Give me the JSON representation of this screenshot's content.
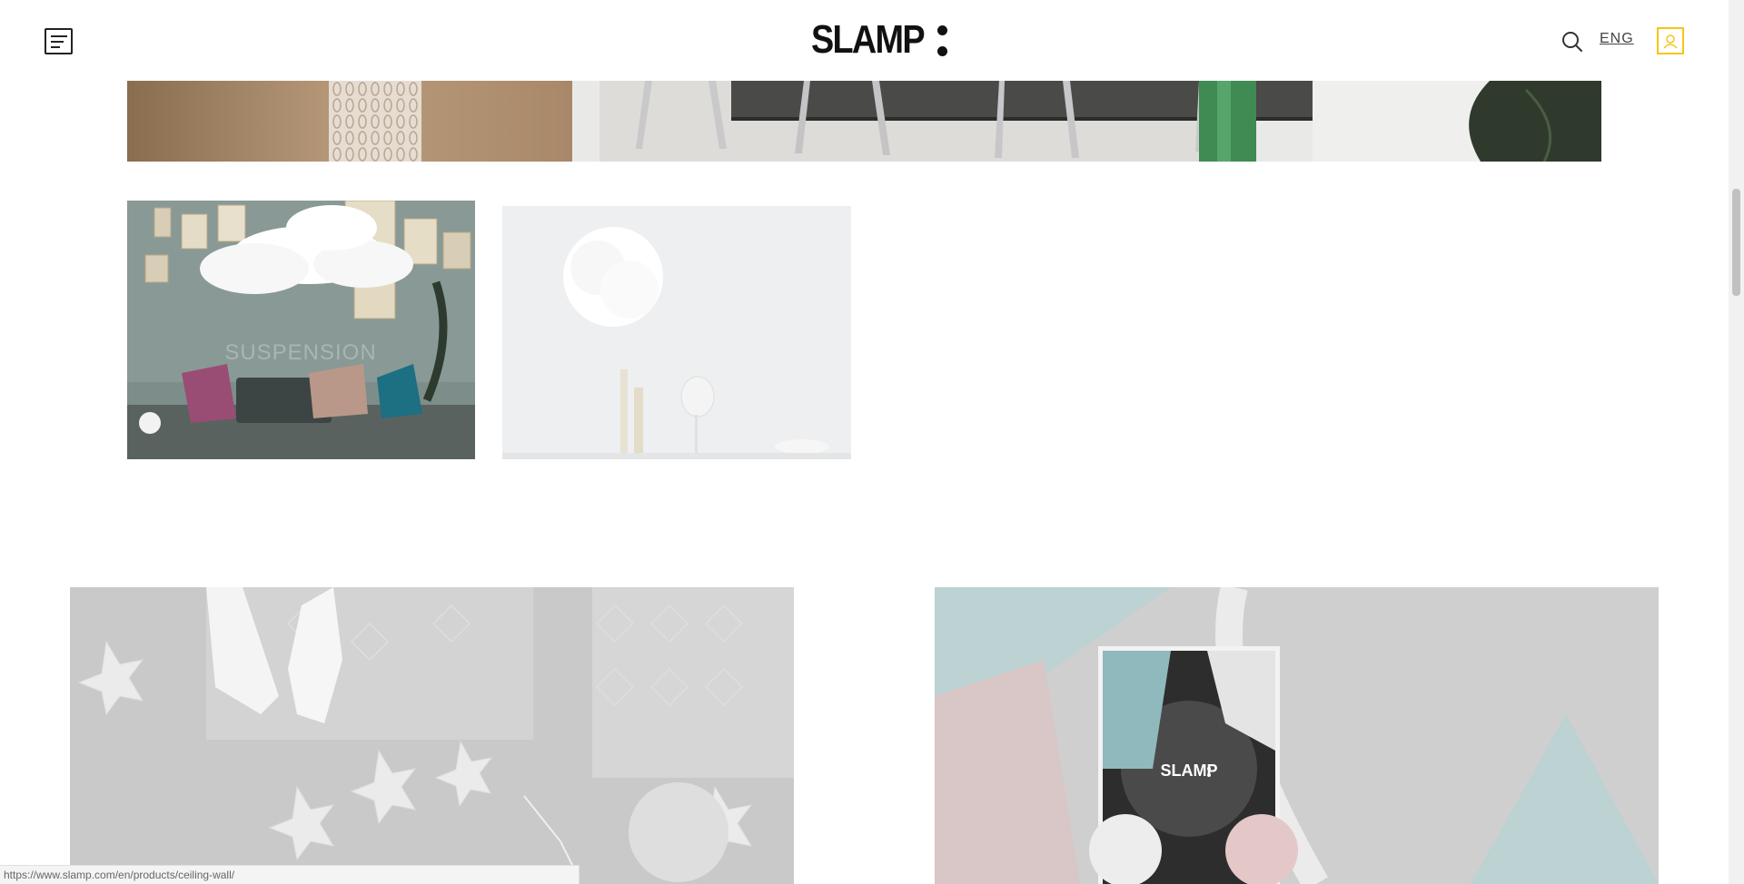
{
  "header": {
    "logo_text": "SLAMP",
    "language_label": "ENG",
    "icons": {
      "menu": "menu-icon",
      "search": "search-icon",
      "account": "account-icon"
    },
    "accent_color": "#f5c518"
  },
  "gallery": {
    "card_1_overlay_text": "SUSPENSION"
  },
  "promo": {
    "catalog_logo_text": "SLAMP"
  },
  "status_bar": {
    "url": "https://www.slamp.com/en/products/ceiling-wall/"
  }
}
